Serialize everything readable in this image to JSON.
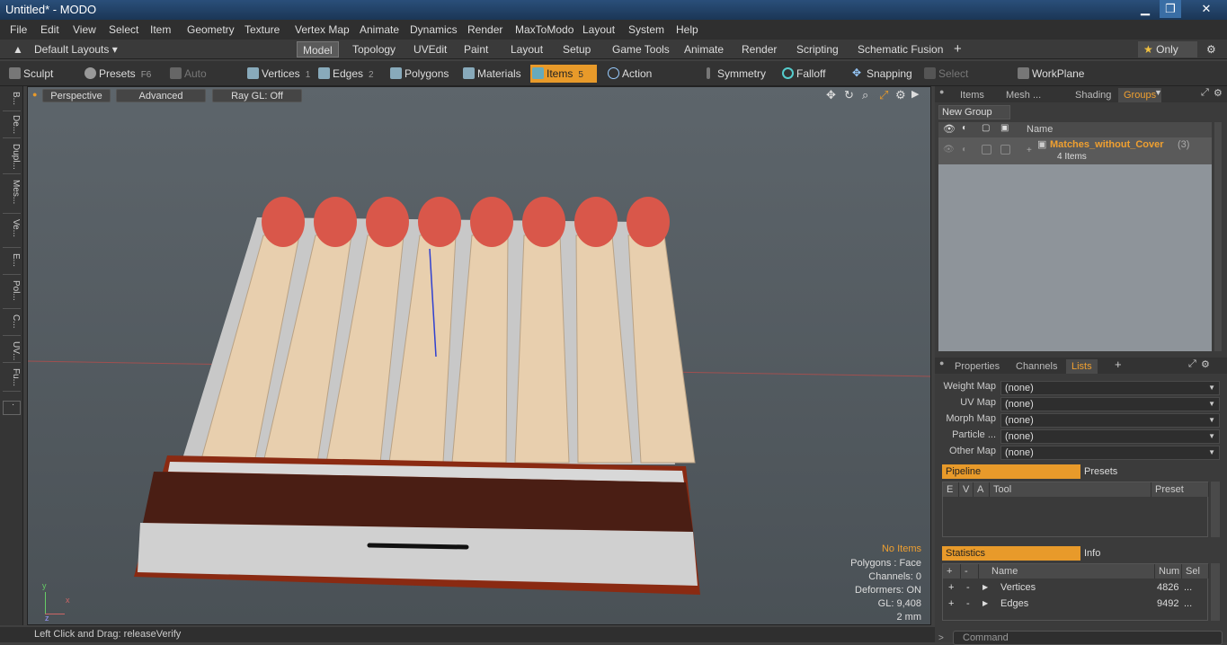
{
  "window": {
    "title": "Untitled* - MODO"
  },
  "menu": [
    "File",
    "Edit",
    "View",
    "Select",
    "Item",
    "Geometry",
    "Texture",
    "Vertex Map",
    "Animate",
    "Dynamics",
    "Render",
    "MaxToModo",
    "Layout",
    "System",
    "Help"
  ],
  "layout": {
    "preset": "Default Layouts",
    "tabs": [
      "Model",
      "Topology",
      "UVEdit",
      "Paint",
      "Layout",
      "Setup",
      "Game Tools",
      "Animate",
      "Render",
      "Scripting",
      "Schematic Fusion"
    ],
    "active": "Model",
    "only": "Only"
  },
  "toolbar": {
    "sculpt": "Sculpt",
    "presets": "Presets",
    "presets_key": "F6",
    "auto_select": "Auto Select",
    "vertices": "Vertices",
    "vertices_key": "1",
    "edges": "Edges",
    "edges_key": "2",
    "polygons": "Polygons",
    "materials": "Materials",
    "items": "Items",
    "items_key": "5",
    "action_center": "Action Center",
    "symmetry": "Symmetry",
    "falloff": "Falloff",
    "snapping": "Snapping",
    "select_through": "Select Through",
    "workplane": "WorkPlane"
  },
  "lefttabs": [
    "B...",
    "De...",
    "Dupl...",
    "Mes...",
    "Ve...",
    "E...",
    "Pol...",
    "C...",
    "UV...",
    "Fu..."
  ],
  "viewport": {
    "perspective": "Perspective",
    "advanced": "Advanced",
    "raygl": "Ray GL: Off",
    "no_items": "No Items",
    "polygons": "Polygons : Face",
    "channels": "Channels: 0",
    "deformers": "Deformers: ON",
    "gl": "GL: 9,408",
    "scale": "2 mm"
  },
  "status": {
    "text": "Left Click and Drag:  releaseVerify"
  },
  "groups": {
    "tabs": [
      "Items",
      "Mesh ...",
      "Shading",
      "Groups"
    ],
    "active": "Groups",
    "new_group": "New Group",
    "col_name": "Name",
    "item_name": "Matches_without_Cover",
    "item_count": "(3)",
    "item_sub": "4 Items"
  },
  "lists": {
    "tabs": [
      "Properties",
      "Channels",
      "Lists"
    ],
    "active": "Lists",
    "maps": [
      {
        "label": "Weight Map",
        "value": "(none)"
      },
      {
        "label": "UV Map",
        "value": "(none)"
      },
      {
        "label": "Morph Map",
        "value": "(none)"
      },
      {
        "label": "Particle ...",
        "value": "(none)"
      },
      {
        "label": "Other Map",
        "value": "(none)"
      }
    ],
    "pipeline": "Pipeline",
    "presets": "Presets",
    "cols": [
      "E",
      "V",
      "A",
      "Tool",
      "Preset"
    ],
    "statistics": "Statistics",
    "info": "Info",
    "stat_cols": [
      "+",
      "-",
      "Name",
      "Num",
      "Sel"
    ],
    "stats": [
      {
        "name": "Vertices",
        "num": "4826",
        "sel": "..."
      },
      {
        "name": "Edges",
        "num": "9492",
        "sel": "..."
      }
    ],
    "command": "Command"
  },
  "colors": {
    "accent": "#e89a2a",
    "match_head": "#d9574a",
    "match_stick": "#e8cfae"
  }
}
